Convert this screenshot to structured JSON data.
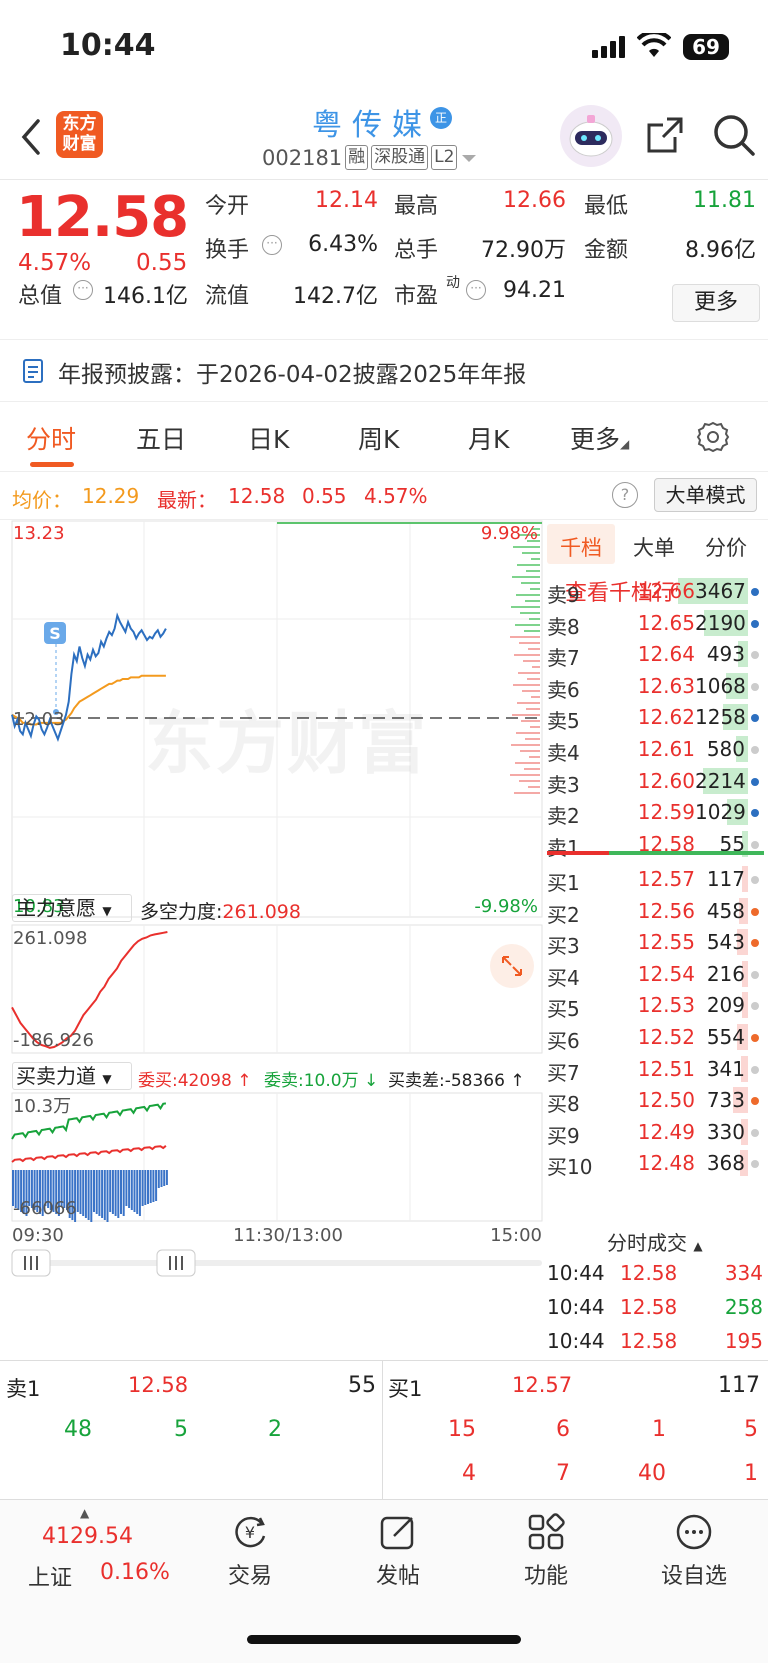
{
  "status_bar": {
    "time": "10:44",
    "battery": "69"
  },
  "header": {
    "logo_line1": "东方",
    "logo_line2": "财富",
    "stock_name": "粤传媒",
    "cert_badge": "正",
    "code": "002181",
    "tags": [
      "融",
      "深股通",
      "L2"
    ]
  },
  "quote": {
    "last_price": "12.58",
    "change_pct": "4.57%",
    "change": "0.55",
    "fields": [
      {
        "label": "今开",
        "value": "12.14",
        "color": "red"
      },
      {
        "label": "最高",
        "value": "12.66",
        "color": "red"
      },
      {
        "label": "最低",
        "value": "11.81",
        "color": "green"
      },
      {
        "label": "换手",
        "value": "6.43%",
        "color": "black"
      },
      {
        "label": "总手",
        "value": "72.90万",
        "color": "black"
      },
      {
        "label": "金额",
        "value": "8.96亿",
        "color": "black"
      },
      {
        "label": "总值",
        "value": "146.1亿",
        "color": "black"
      },
      {
        "label": "流值",
        "value": "142.7亿",
        "color": "black"
      },
      {
        "label": "市盈",
        "sup": "动",
        "value": "94.21",
        "color": "black"
      }
    ],
    "more_button": "更多"
  },
  "notice": {
    "text": "年报预披露：于2026-04-02披露2025年年报"
  },
  "tabs": [
    {
      "label": "分时",
      "active": true
    },
    {
      "label": "五日",
      "active": false
    },
    {
      "label": "日K",
      "active": false
    },
    {
      "label": "周K",
      "active": false
    },
    {
      "label": "月K",
      "active": false
    },
    {
      "label": "更多",
      "active": false
    }
  ],
  "avg_row": {
    "avg_label": "均价：",
    "avg_value": "12.29",
    "latest_label": "最新：",
    "latest_value": "12.58",
    "change": "0.55",
    "pct": "4.57%",
    "help": "?",
    "mode_button": "大单模式"
  },
  "chart_data": {
    "type": "line",
    "y_max": "13.23",
    "y_min": "10.83",
    "y_ref": "12.03",
    "pct_max": "9.98%",
    "pct_min": "-9.98%",
    "x_labels": [
      "09:30",
      "11:30/13:00",
      "15:00"
    ],
    "watermark": "东方财富",
    "signal_marker": "S",
    "series": [
      {
        "name": "price",
        "color": "#2c6fc0",
        "values": [
          12.05,
          11.98,
          12.02,
          11.95,
          11.93,
          12.0,
          11.96,
          11.92,
          11.99,
          12.04,
          12.02,
          11.96,
          11.93,
          11.97,
          12.02,
          11.98,
          11.94,
          11.9,
          11.95,
          12.0,
          12.05,
          12.13,
          12.3,
          12.42,
          12.38,
          12.47,
          12.4,
          12.35,
          12.42,
          12.39,
          12.45,
          12.41,
          12.43,
          12.5,
          12.47,
          12.52,
          12.56,
          12.54,
          12.58,
          12.66,
          12.62,
          12.59,
          12.56,
          12.62,
          12.58,
          12.56,
          12.52,
          12.55,
          12.57,
          12.54,
          12.51,
          12.53,
          12.52,
          12.55,
          12.57,
          12.53,
          12.55,
          12.58
        ]
      },
      {
        "name": "avg",
        "color": "#f39a1e",
        "values": [
          12.05,
          12.04,
          12.03,
          12.02,
          12.0,
          12.0,
          12.0,
          11.99,
          11.99,
          11.99,
          12.0,
          12.0,
          12.0,
          12.0,
          12.0,
          12.0,
          12.0,
          12.0,
          12.0,
          12.01,
          12.02,
          12.04,
          12.06,
          12.09,
          12.11,
          12.13,
          12.14,
          12.15,
          12.16,
          12.17,
          12.18,
          12.19,
          12.2,
          12.21,
          12.22,
          12.23,
          12.24,
          12.24,
          12.25,
          12.26,
          12.26,
          12.27,
          12.27,
          12.27,
          12.28,
          12.28,
          12.28,
          12.28,
          12.29,
          12.29,
          12.29,
          12.29,
          12.29,
          12.29,
          12.29,
          12.29,
          12.29,
          12.29
        ]
      }
    ],
    "indicator1": {
      "selector": "主力意愿",
      "label": "多空力度:",
      "value": "261.098",
      "max_label": "261.098",
      "min_label": "-186.926",
      "values": [
        -30,
        -60,
        -90,
        -110,
        -130,
        -150,
        -165,
        -175,
        -180,
        -186,
        -183,
        -175,
        -165,
        -150,
        -140,
        -120,
        -90,
        -60,
        -40,
        -20,
        0,
        30,
        50,
        80,
        100,
        120,
        150,
        170,
        190,
        210,
        225,
        235,
        240,
        248,
        252,
        255,
        258,
        261
      ]
    },
    "indicator2": {
      "selector": "买卖力道",
      "wei_mai_label": "委买:",
      "wei_mai_value": "42098",
      "wei_mai_arrow": "↑",
      "wei_mai_suffix": "",
      "wei_mai_display": "委买:42098 ↑",
      "wei_mai2_display": "委卖:10.0万 ↓",
      "diff_display": "买卖差:-58366 ↑",
      "max_label": "10.3万",
      "min_label": "-66066"
    }
  },
  "order_book": {
    "tabs": [
      "千档",
      "大单",
      "分价"
    ],
    "link": "查看千档行情 >",
    "asks": [
      {
        "label": "卖9",
        "price": "12.66",
        "vol": "3467",
        "bar": 1.0,
        "dot": "#2c6fc0"
      },
      {
        "label": "卖8",
        "price": "12.65",
        "vol": "2190",
        "bar": 0.63,
        "dot": "#2c6fc0"
      },
      {
        "label": "卖7",
        "price": "12.64",
        "vol": "493",
        "bar": 0.14,
        "dot": "#ccc"
      },
      {
        "label": "卖6",
        "price": "12.63",
        "vol": "1068",
        "bar": 0.31,
        "dot": "#ccc"
      },
      {
        "label": "卖5",
        "price": "12.62",
        "vol": "1258",
        "bar": 0.36,
        "dot": "#2c6fc0"
      },
      {
        "label": "卖4",
        "price": "12.61",
        "vol": "580",
        "bar": 0.17,
        "dot": "#ccc"
      },
      {
        "label": "卖3",
        "price": "12.60",
        "vol": "2214",
        "bar": 0.64,
        "dot": "#2c6fc0"
      },
      {
        "label": "卖2",
        "price": "12.59",
        "vol": "1029",
        "bar": 0.3,
        "dot": "#2c6fc0"
      },
      {
        "label": "卖1",
        "price": "12.58",
        "vol": "55",
        "bar": 0.02,
        "dot": "#ccc"
      }
    ],
    "bids": [
      {
        "label": "买1",
        "price": "12.57",
        "vol": "117",
        "bar": 0.03,
        "dot": "#ccc"
      },
      {
        "label": "买2",
        "price": "12.56",
        "vol": "458",
        "bar": 0.13,
        "dot": "#ee6a2b"
      },
      {
        "label": "买3",
        "price": "12.55",
        "vol": "543",
        "bar": 0.16,
        "dot": "#ee6a2b"
      },
      {
        "label": "买4",
        "price": "12.54",
        "vol": "216",
        "bar": 0.06,
        "dot": "#ccc"
      },
      {
        "label": "买5",
        "price": "12.53",
        "vol": "209",
        "bar": 0.06,
        "dot": "#ccc"
      },
      {
        "label": "买6",
        "price": "12.52",
        "vol": "554",
        "bar": 0.16,
        "dot": "#ee6a2b"
      },
      {
        "label": "买7",
        "price": "12.51",
        "vol": "341",
        "bar": 0.1,
        "dot": "#ccc"
      },
      {
        "label": "买8",
        "price": "12.50",
        "vol": "733",
        "bar": 0.21,
        "dot": "#ee6a2b"
      },
      {
        "label": "买9",
        "price": "12.49",
        "vol": "330",
        "bar": 0.1,
        "dot": "#ccc"
      },
      {
        "label": "买10",
        "price": "12.48",
        "vol": "368",
        "bar": 0.11,
        "dot": "#ccc"
      }
    ],
    "trades_header": "分时成交",
    "trades": [
      {
        "time": "10:44",
        "price": "12.58",
        "vol": "334",
        "side": "red"
      },
      {
        "time": "10:44",
        "price": "12.58",
        "vol": "258",
        "side": "green"
      },
      {
        "time": "10:44",
        "price": "12.58",
        "vol": "195",
        "side": "red"
      }
    ]
  },
  "depth": {
    "sell_label": "卖1",
    "sell_price": "12.58",
    "sell_vol": "55",
    "buy_label": "买1",
    "buy_price": "12.57",
    "buy_vol": "117",
    "sell_queue": [
      "48",
      "5",
      "2"
    ],
    "buy_queue_row1": [
      "15",
      "6",
      "1",
      "5"
    ],
    "buy_queue_row2": [
      "4",
      "7",
      "40",
      "1"
    ]
  },
  "bottom_nav": {
    "index_value": "4129.54",
    "index_name": "上证",
    "index_pct": "0.16%",
    "items": [
      {
        "label": "交易",
        "icon": "trade-icon"
      },
      {
        "label": "发帖",
        "icon": "post-icon"
      },
      {
        "label": "功能",
        "icon": "apps-icon"
      },
      {
        "label": "设自选",
        "icon": "more-icon"
      }
    ]
  },
  "colors": {
    "up": "#e9302d",
    "down": "#17a33b",
    "accent": "#f05a22",
    "price_line": "#2c6fc0",
    "avg_line": "#f39a1e"
  }
}
